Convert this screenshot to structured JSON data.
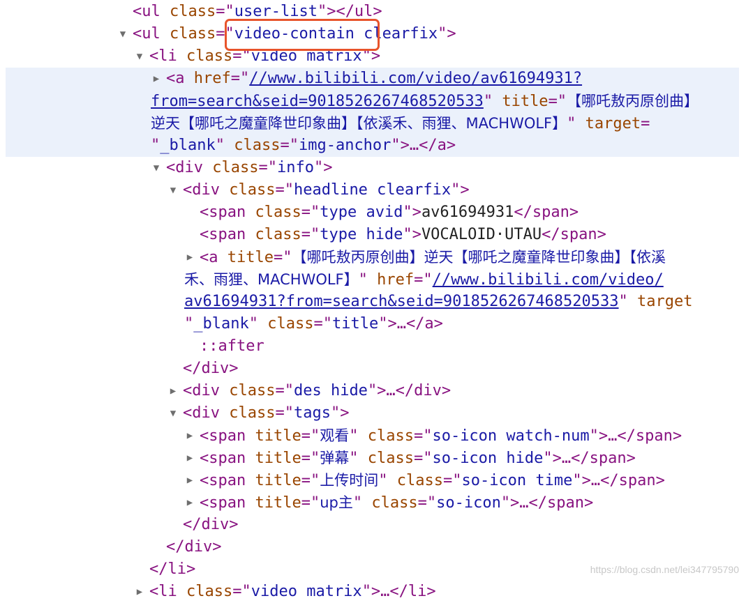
{
  "focus_box": {
    "color": "#e8542b"
  },
  "watermark": "https://blog.csdn.net/lei347795790",
  "rows": [
    {
      "indent": 190,
      "toggle": "",
      "parts": [
        [
          "t",
          "<ul"
        ],
        [
          "s",
          " "
        ],
        [
          "a",
          "class"
        ],
        [
          "t",
          "=\""
        ],
        [
          "v",
          "user-list"
        ],
        [
          "t",
          "\"></ul>"
        ]
      ]
    },
    {
      "indent": 190,
      "toggle": "open",
      "parts": [
        [
          "t",
          "<ul"
        ],
        [
          "s",
          " "
        ],
        [
          "a",
          "class"
        ],
        [
          "t",
          "=\""
        ],
        [
          "v",
          "video-contain clearfix"
        ],
        [
          "t",
          "\">"
        ]
      ]
    },
    {
      "indent": 214,
      "toggle": "open",
      "parts": [
        [
          "t",
          "<li"
        ],
        [
          "s",
          " "
        ],
        [
          "a",
          "class"
        ],
        [
          "t",
          "=\""
        ],
        [
          "v",
          "video matrix"
        ],
        [
          "t",
          "\">"
        ]
      ]
    },
    {
      "indent": 238,
      "toggle": "closed",
      "highlight": true,
      "parts": [
        [
          "t",
          "<a"
        ],
        [
          "s",
          " "
        ],
        [
          "a",
          "href"
        ],
        [
          "t",
          "=\""
        ],
        [
          "l",
          "//www.bilibili.com/video/av61694931?"
        ]
      ]
    },
    {
      "indent": 216,
      "toggle": "",
      "highlight": true,
      "parts": [
        [
          "l",
          "from=search&seid=9018526267468520533"
        ],
        [
          "t",
          "\""
        ],
        [
          "s",
          " "
        ],
        [
          "a",
          "title"
        ],
        [
          "t",
          "=\""
        ],
        [
          "v",
          "【哪吒敖丙原创曲】"
        ]
      ]
    },
    {
      "indent": 216,
      "toggle": "",
      "highlight": true,
      "parts": [
        [
          "v",
          "逆天【哪吒之魔童降世印象曲】【依溪禾、雨狸、MACHWOLF】"
        ],
        [
          "t",
          "\""
        ],
        [
          "s",
          " "
        ],
        [
          "a",
          "target"
        ],
        [
          "t",
          "="
        ]
      ]
    },
    {
      "indent": 216,
      "toggle": "",
      "highlight": true,
      "parts": [
        [
          "t",
          "\""
        ],
        [
          "v",
          "_blank"
        ],
        [
          "t",
          "\""
        ],
        [
          "s",
          " "
        ],
        [
          "a",
          "class"
        ],
        [
          "t",
          "=\""
        ],
        [
          "v",
          "img-anchor"
        ],
        [
          "t",
          "\">…</a>"
        ]
      ]
    },
    {
      "indent": 238,
      "toggle": "open",
      "parts": [
        [
          "t",
          "<div"
        ],
        [
          "s",
          " "
        ],
        [
          "a",
          "class"
        ],
        [
          "t",
          "=\""
        ],
        [
          "v",
          "info"
        ],
        [
          "t",
          "\">"
        ]
      ]
    },
    {
      "indent": 262,
      "toggle": "open",
      "parts": [
        [
          "t",
          "<div"
        ],
        [
          "s",
          " "
        ],
        [
          "a",
          "class"
        ],
        [
          "t",
          "=\""
        ],
        [
          "v",
          "headline clearfix"
        ],
        [
          "t",
          "\">"
        ]
      ]
    },
    {
      "indent": 286,
      "toggle": "",
      "parts": [
        [
          "t",
          "<span"
        ],
        [
          "s",
          " "
        ],
        [
          "a",
          "class"
        ],
        [
          "t",
          "=\""
        ],
        [
          "v",
          "type avid"
        ],
        [
          "t",
          "\">"
        ],
        [
          "x",
          "av61694931"
        ],
        [
          "t",
          "</span>"
        ]
      ]
    },
    {
      "indent": 286,
      "toggle": "",
      "parts": [
        [
          "t",
          "<span"
        ],
        [
          "s",
          " "
        ],
        [
          "a",
          "class"
        ],
        [
          "t",
          "=\""
        ],
        [
          "v",
          "type hide"
        ],
        [
          "t",
          "\">"
        ],
        [
          "x",
          "VOCALOID·UTAU"
        ],
        [
          "t",
          "</span>"
        ]
      ]
    },
    {
      "indent": 286,
      "toggle": "closed",
      "parts": [
        [
          "t",
          "<a"
        ],
        [
          "s",
          " "
        ],
        [
          "a",
          "title"
        ],
        [
          "t",
          "=\""
        ],
        [
          "v",
          "【哪吒敖丙原创曲】逆天【哪吒之魔童降世印象曲】【依溪"
        ]
      ]
    },
    {
      "indent": 264,
      "toggle": "",
      "parts": [
        [
          "v",
          "禾、雨狸、MACHWOLF】"
        ],
        [
          "t",
          "\""
        ],
        [
          "s",
          " "
        ],
        [
          "a",
          "href"
        ],
        [
          "t",
          "=\""
        ],
        [
          "l",
          "//www.bilibili.com/video/"
        ]
      ]
    },
    {
      "indent": 264,
      "toggle": "",
      "parts": [
        [
          "l",
          "av61694931?from=search&seid=9018526267468520533"
        ],
        [
          "t",
          "\""
        ],
        [
          "s",
          " "
        ],
        [
          "a",
          "target"
        ]
      ]
    },
    {
      "indent": 264,
      "toggle": "",
      "parts": [
        [
          "t",
          "\""
        ],
        [
          "v",
          "_blank"
        ],
        [
          "t",
          "\""
        ],
        [
          "s",
          " "
        ],
        [
          "a",
          "class"
        ],
        [
          "t",
          "=\""
        ],
        [
          "v",
          "title"
        ],
        [
          "t",
          "\">…</a>"
        ]
      ]
    },
    {
      "indent": 286,
      "toggle": "",
      "parts": [
        [
          "p",
          "::after"
        ]
      ]
    },
    {
      "indent": 262,
      "toggle": "",
      "parts": [
        [
          "t",
          "</div>"
        ]
      ]
    },
    {
      "indent": 262,
      "toggle": "closed",
      "parts": [
        [
          "t",
          "<div"
        ],
        [
          "s",
          " "
        ],
        [
          "a",
          "class"
        ],
        [
          "t",
          "=\""
        ],
        [
          "v",
          "des hide"
        ],
        [
          "t",
          "\">…</div>"
        ]
      ]
    },
    {
      "indent": 262,
      "toggle": "open",
      "parts": [
        [
          "t",
          "<div"
        ],
        [
          "s",
          " "
        ],
        [
          "a",
          "class"
        ],
        [
          "t",
          "=\""
        ],
        [
          "v",
          "tags"
        ],
        [
          "t",
          "\">"
        ]
      ]
    },
    {
      "indent": 286,
      "toggle": "closed",
      "parts": [
        [
          "t",
          "<span"
        ],
        [
          "s",
          " "
        ],
        [
          "a",
          "title"
        ],
        [
          "t",
          "=\""
        ],
        [
          "v",
          "观看"
        ],
        [
          "t",
          "\""
        ],
        [
          "s",
          " "
        ],
        [
          "a",
          "class"
        ],
        [
          "t",
          "=\""
        ],
        [
          "v",
          "so-icon watch-num"
        ],
        [
          "t",
          "\">…</span>"
        ]
      ]
    },
    {
      "indent": 286,
      "toggle": "closed",
      "parts": [
        [
          "t",
          "<span"
        ],
        [
          "s",
          " "
        ],
        [
          "a",
          "title"
        ],
        [
          "t",
          "=\""
        ],
        [
          "v",
          "弹幕"
        ],
        [
          "t",
          "\""
        ],
        [
          "s",
          " "
        ],
        [
          "a",
          "class"
        ],
        [
          "t",
          "=\""
        ],
        [
          "v",
          "so-icon hide"
        ],
        [
          "t",
          "\">…</span>"
        ]
      ]
    },
    {
      "indent": 286,
      "toggle": "closed",
      "parts": [
        [
          "t",
          "<span"
        ],
        [
          "s",
          " "
        ],
        [
          "a",
          "title"
        ],
        [
          "t",
          "=\""
        ],
        [
          "v",
          "上传时间"
        ],
        [
          "t",
          "\""
        ],
        [
          "s",
          " "
        ],
        [
          "a",
          "class"
        ],
        [
          "t",
          "=\""
        ],
        [
          "v",
          "so-icon time"
        ],
        [
          "t",
          "\">…</span>"
        ]
      ]
    },
    {
      "indent": 286,
      "toggle": "closed",
      "parts": [
        [
          "t",
          "<span"
        ],
        [
          "s",
          " "
        ],
        [
          "a",
          "title"
        ],
        [
          "t",
          "=\""
        ],
        [
          "v",
          "up主"
        ],
        [
          "t",
          "\""
        ],
        [
          "s",
          " "
        ],
        [
          "a",
          "class"
        ],
        [
          "t",
          "=\""
        ],
        [
          "v",
          "so-icon"
        ],
        [
          "t",
          "\">…</span>"
        ]
      ]
    },
    {
      "indent": 262,
      "toggle": "",
      "parts": [
        [
          "t",
          "</div>"
        ]
      ]
    },
    {
      "indent": 238,
      "toggle": "",
      "parts": [
        [
          "t",
          "</div>"
        ]
      ]
    },
    {
      "indent": 214,
      "toggle": "",
      "parts": [
        [
          "t",
          "</li>"
        ]
      ]
    },
    {
      "indent": 214,
      "toggle": "closed",
      "parts": [
        [
          "t",
          "<li"
        ],
        [
          "s",
          " "
        ],
        [
          "a",
          "class"
        ],
        [
          "t",
          "=\""
        ],
        [
          "v",
          "video matrix"
        ],
        [
          "t",
          "\">…</li>"
        ]
      ]
    }
  ]
}
